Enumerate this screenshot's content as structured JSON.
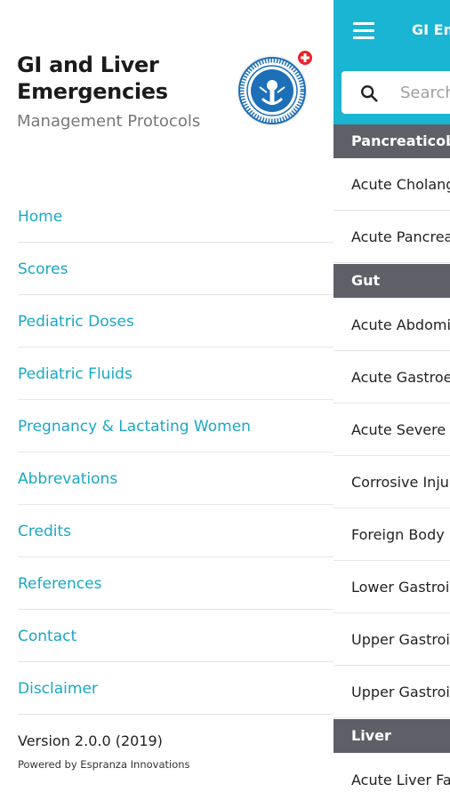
{
  "drawer": {
    "app_title": "GI and Liver Emergencies",
    "app_subtitle": "Management Protocols",
    "logo_icon": "institute-seal-logo",
    "menu": [
      {
        "label": "Home"
      },
      {
        "label": "Scores"
      },
      {
        "label": "Pediatric Doses"
      },
      {
        "label": "Pediatric Fluids"
      },
      {
        "label": "Pregnancy & Lactating Women"
      },
      {
        "label": "Abbrevations"
      },
      {
        "label": "Credits"
      },
      {
        "label": "References"
      },
      {
        "label": "Contact"
      },
      {
        "label": "Disclaimer"
      }
    ],
    "version": "Version 2.0.0 (2019)",
    "powered_by": "Powered by Espranza Innovations"
  },
  "main": {
    "title": "GI Em",
    "search_placeholder": "Search",
    "sections": [
      {
        "title": "Pancreaticobi",
        "items": [
          "Acute Cholang",
          "Acute Pancrea"
        ]
      },
      {
        "title": "Gut",
        "items": [
          "Acute Abdomi",
          "Acute Gastroe",
          "Acute Severe U",
          "Corrosive Inju",
          "Foreign Body I",
          "Lower Gastroi",
          "Upper Gastroi",
          "Upper Gastroi"
        ]
      },
      {
        "title": "Liver",
        "items": [
          "Acute Liver Fa"
        ]
      }
    ]
  },
  "colors": {
    "accent": "#1ab5d2",
    "menu_text": "#1aa7c4",
    "section_header": "#5f5f68",
    "badge_red": "#e8232a",
    "seal_blue": "#1d6fb8"
  }
}
